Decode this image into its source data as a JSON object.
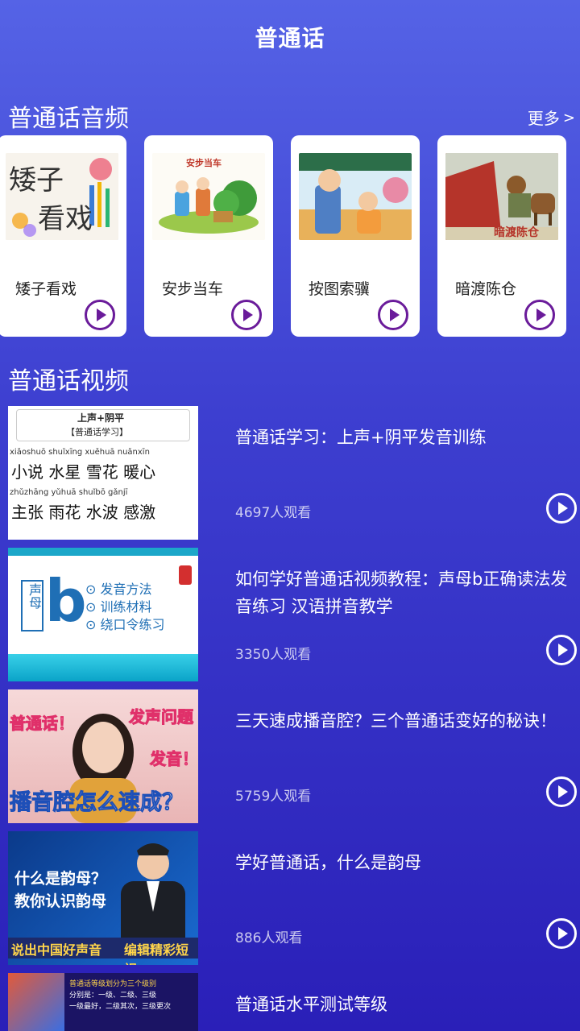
{
  "header": {
    "title": "普通话"
  },
  "audio_section": {
    "title": "普通话音频",
    "more_label": "更多",
    "items": [
      {
        "label": "矮子看戏",
        "thumb_text_1": "矮子",
        "thumb_text_2": "看戏"
      },
      {
        "label": "安步当车",
        "thumb_text": "安步当车"
      },
      {
        "label": "按图索骥"
      },
      {
        "label": "暗渡陈仓",
        "thumb_text": "暗渡陈仓"
      }
    ]
  },
  "video_section": {
    "title": "普通话视频",
    "items": [
      {
        "title": "普通话学习：上声+阴平发音训练",
        "views": "4697人观看",
        "thumb": {
          "heading": "上声+阴平",
          "sub": "【普通话学习】",
          "row1_pinyin": "xiǎoshuō shuǐxīng xuěhuā nuǎnxīn",
          "row1": "小说  水星  雪花  暖心",
          "row2_pinyin": "zhǔzhāng yǔhuā shuǐbō gǎnjī",
          "row2": "主张  雨花  水波  感激"
        }
      },
      {
        "title": "如何学好普通话视频教程：声母b正确读法发音练习 汉语拼音教学",
        "views": "3350人观看",
        "thumb": {
          "side": "声母",
          "letter": "b",
          "p1": "⊙ 发音方法",
          "p2": "⊙ 训练材料",
          "p3": "⊙ 绕口令练习"
        }
      },
      {
        "title": "三天速成播音腔？三个普通话变好的秘诀！",
        "views": "5759人观看",
        "thumb": {
          "tl": "普通话！",
          "tr": "发声问题",
          "mr": "发音！",
          "bottom": "播音腔怎么速成？"
        }
      },
      {
        "title": "学好普通话，什么是韵母",
        "views": "886人观看",
        "thumb": {
          "l1": "什么是韵母？",
          "l2": "教你认识韵母",
          "b1": "说出中国好声音",
          "b2": "编辑精彩短视"
        }
      },
      {
        "title": "普通话水平测试等级",
        "views": "",
        "thumb": {
          "l1": "普通话等级划分为三个级别",
          "l2": "分别是：一级、二级、三级",
          "l3": "一级最好，二级其次，三级更次"
        }
      }
    ]
  },
  "colors": {
    "bg_top": "#5563e6",
    "bg_bottom": "#2a1fb8",
    "accent_play": "#6a1b9a"
  }
}
